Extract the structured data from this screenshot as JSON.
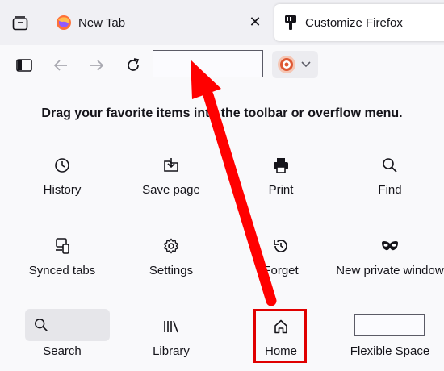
{
  "tabs": {
    "newtab_label": "New Tab",
    "newtab_close": "✕",
    "customize_label": "Customize Firefox"
  },
  "heading": "Drag your favorite items into the toolbar or overflow menu.",
  "palette": [
    {
      "label": "History",
      "icon": "history-icon"
    },
    {
      "label": "Save page",
      "icon": "save-page-icon"
    },
    {
      "label": "Print",
      "icon": "print-icon"
    },
    {
      "label": "Find",
      "icon": "find-icon"
    },
    {
      "label": "Synced tabs",
      "icon": "synced-tabs-icon"
    },
    {
      "label": "Settings",
      "icon": "settings-icon"
    },
    {
      "label": "Forget",
      "icon": "forget-icon"
    },
    {
      "label": "New private window",
      "icon": "private-window-icon"
    },
    {
      "label": "Search",
      "icon": "search-icon"
    },
    {
      "label": "Library",
      "icon": "library-icon"
    },
    {
      "label": "Home",
      "icon": "home-icon"
    },
    {
      "label": "Flexible Space",
      "icon": "flexible-space"
    }
  ],
  "colors": {
    "annotation": "#e00000",
    "tabbar_bg": "#f0f0f4",
    "page_bg": "#f9f9fb"
  }
}
